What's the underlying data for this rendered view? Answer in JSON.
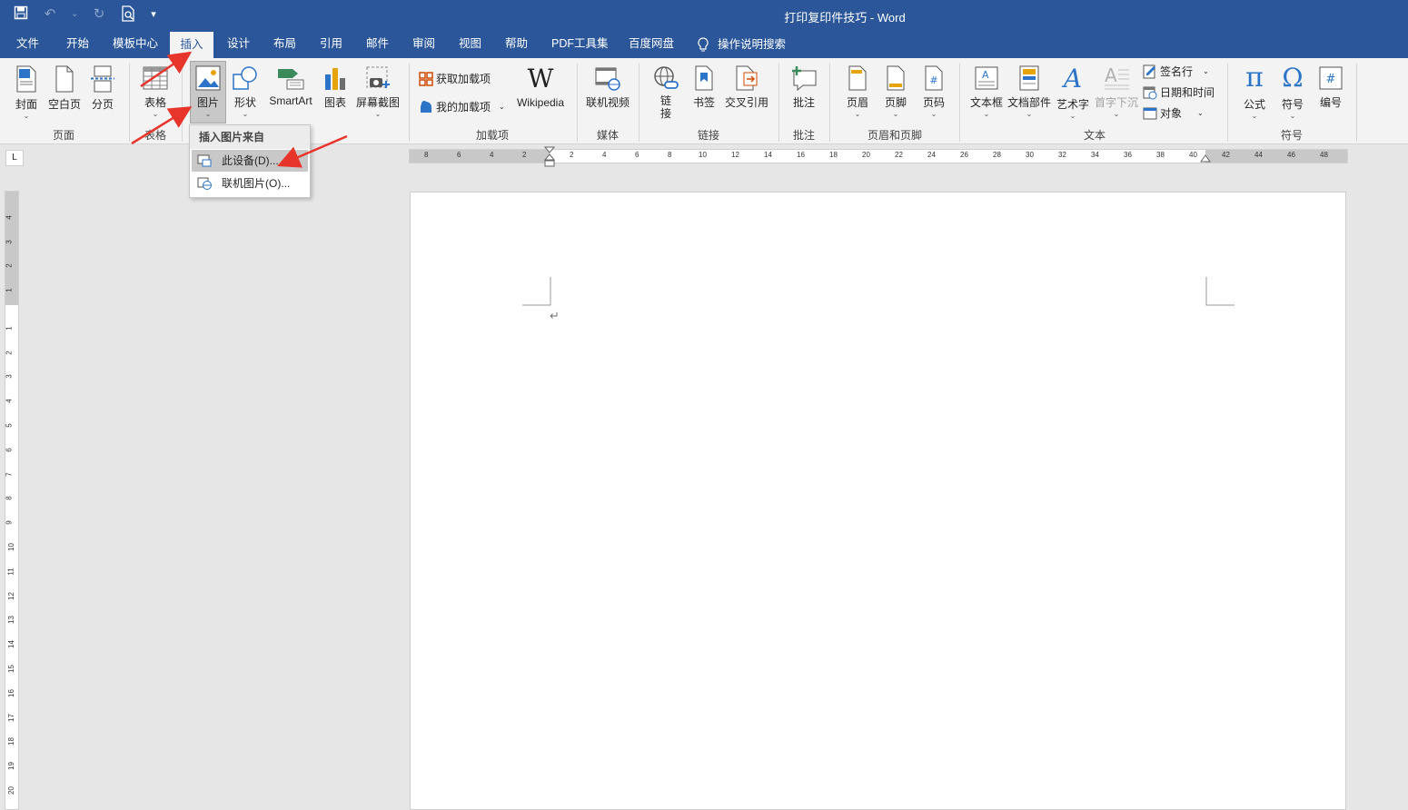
{
  "window": {
    "title": "打印复印件技巧 - Word"
  },
  "qat": {
    "save": "💾",
    "undo": "↶",
    "undo_dd": "⌄",
    "redo": "↻",
    "preview": "🔍",
    "customize": "▾"
  },
  "tabs": [
    "文件",
    "开始",
    "模板中心",
    "插入",
    "设计",
    "布局",
    "引用",
    "邮件",
    "审阅",
    "视图",
    "帮助",
    "PDF工具集",
    "百度网盘"
  ],
  "search": {
    "label": "操作说明搜索"
  },
  "ribbon": {
    "groups": {
      "pages": "页面",
      "tables": "表格",
      "addins": "加载项",
      "media": "媒体",
      "links": "链接",
      "comments": "批注",
      "header_footer": "页眉和页脚",
      "text": "文本",
      "symbols": "符号"
    },
    "buttons": {
      "cover": "封面",
      "blank": "空白页",
      "break": "分页",
      "table": "表格",
      "picture": "图片",
      "shapes": "形状",
      "smartart": "SmartArt",
      "chart": "图表",
      "screenshot": "屏幕截图",
      "get_addins": "获取加载项",
      "my_addins": "我的加载项",
      "wikipedia": "Wikipedia",
      "online_video": "联机视频",
      "link": "链\n接",
      "bookmark": "书签",
      "crossref": "交叉引用",
      "comment": "批注",
      "header": "页眉",
      "footer": "页脚",
      "pagenum": "页码",
      "textbox": "文本框",
      "quickparts": "文档部件",
      "wordart": "艺术字",
      "dropcap": "首字下沉",
      "signature": "签名行",
      "datetime": "日期和时间",
      "object": "对象",
      "equation": "公式",
      "symbol": "符号",
      "number": "编号"
    }
  },
  "picture_menu": {
    "header": "插入图片来自",
    "items": [
      "此设备(D)...",
      "联机图片(O)..."
    ]
  },
  "ruler": {
    "h_left": [
      "8",
      "6",
      "4",
      "2"
    ],
    "h_right": [
      "2",
      "4",
      "6",
      "8",
      "10",
      "12",
      "14",
      "16",
      "18",
      "20",
      "22",
      "24",
      "26",
      "28",
      "30",
      "32",
      "34",
      "36",
      "38",
      "40",
      "42",
      "44",
      "46",
      "48"
    ],
    "v_top": [
      "4",
      "3",
      "2",
      "1"
    ],
    "v_bottom": [
      "1",
      "2",
      "3",
      "4",
      "5",
      "6",
      "7",
      "8",
      "9",
      "10",
      "11",
      "12",
      "13",
      "14",
      "15",
      "16",
      "17",
      "18",
      "19",
      "20"
    ],
    "corner": "L"
  },
  "document": {
    "paragraph_mark": "↵"
  },
  "colors": {
    "accent": "#2b579a",
    "annotation": "#e8352c"
  }
}
